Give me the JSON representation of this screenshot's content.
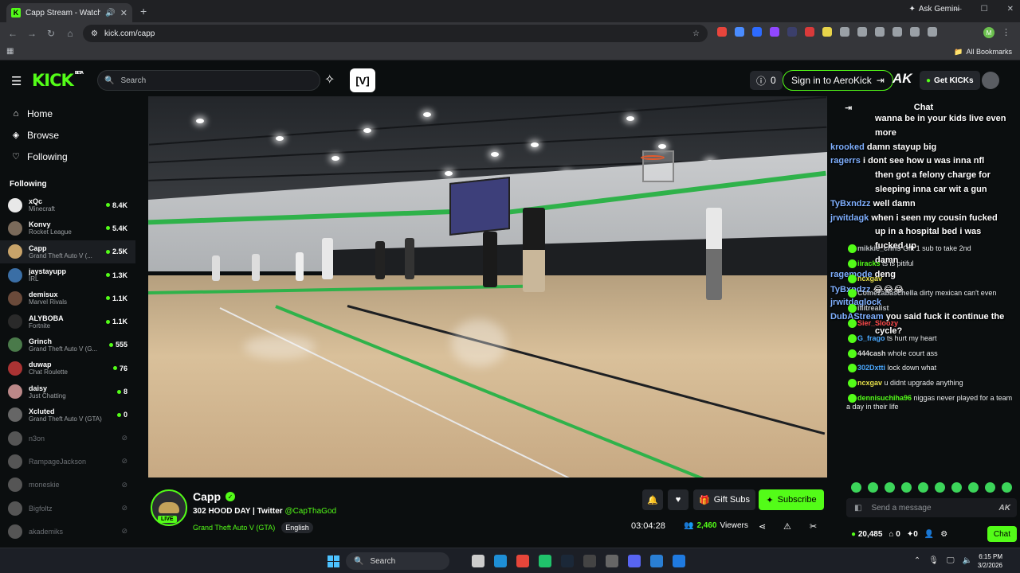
{
  "browser": {
    "tab_title": "Capp Stream - Watch Live ...",
    "tab_favicon": "K",
    "url": "kick.com/capp",
    "ask_gemini": "Ask Gemini",
    "all_bookmarks": "All Bookmarks",
    "profile_initial": "M"
  },
  "header": {
    "logo": "KICK",
    "logo_beta": "BETA",
    "search_placeholder": "Search",
    "notifications": "0",
    "signin_label": "Sign in to AeroKick",
    "ak_logo": "AK",
    "get_kicks": "Get KICKs"
  },
  "sidebar": {
    "nav": [
      {
        "label": "Home",
        "icon": "home-icon"
      },
      {
        "label": "Browse",
        "icon": "compass-icon"
      },
      {
        "label": "Following",
        "icon": "heart-icon"
      }
    ],
    "following_heading": "Following",
    "channels": [
      {
        "name": "xQc",
        "category": "Minecraft",
        "viewers": "8.4K",
        "live": true
      },
      {
        "name": "Konvy",
        "category": "Rocket League",
        "viewers": "5.4K",
        "live": true
      },
      {
        "name": "Capp",
        "category": "Grand Theft Auto V (...",
        "viewers": "2.5K",
        "live": true,
        "active": true
      },
      {
        "name": "jaystayupp",
        "category": "IRL",
        "viewers": "1.3K",
        "live": true
      },
      {
        "name": "demisux",
        "category": "Marvel Rivals",
        "viewers": "1.1K",
        "live": true
      },
      {
        "name": "ALYBOBA",
        "category": "Fortnite",
        "viewers": "1.1K",
        "live": true
      },
      {
        "name": "Grinch",
        "category": "Grand Theft Auto V (G...",
        "viewers": "555",
        "live": true
      },
      {
        "name": "duwap",
        "category": "Chat Roulette",
        "viewers": "76",
        "live": true
      },
      {
        "name": "daisy",
        "category": "Just Chatting",
        "viewers": "8",
        "live": true
      },
      {
        "name": "Xcluted",
        "category": "Grand Theft Auto V (GTA)",
        "viewers": "0",
        "live": true
      },
      {
        "name": "n3on",
        "category": "",
        "viewers": "",
        "live": false
      },
      {
        "name": "RampageJackson",
        "category": "",
        "viewers": "",
        "live": false
      },
      {
        "name": "moneskie",
        "category": "",
        "viewers": "",
        "live": false
      },
      {
        "name": "Bigfoltz",
        "category": "",
        "viewers": "",
        "live": false
      },
      {
        "name": "akademiks",
        "category": "",
        "viewers": "",
        "live": false
      }
    ]
  },
  "stream": {
    "streamer": "Capp",
    "live_badge": "LIVE",
    "title_prefix": "302 HOOD DAY | Twitter",
    "twitter": "@CapThaGod",
    "category": "Grand Theft Auto V (GTA)",
    "language": "English",
    "gift_subs": "Gift Subs",
    "subscribe": "Subscribe",
    "uptime": "03:04:28",
    "viewer_count": "2,460",
    "viewers_label": "Viewers"
  },
  "chat": {
    "title": "Chat",
    "overlay_messages": [
      {
        "user": "",
        "text": "wanna be in your kids live even"
      },
      {
        "user": "",
        "text": "more"
      },
      {
        "user": "krooked",
        "text": "damn stayup big"
      },
      {
        "user": "ragerrs",
        "text": "i dont see how u was inna nfl"
      },
      {
        "user": "",
        "text": "then got a felony charge for"
      },
      {
        "user": "",
        "text": "sleeping inna car wit a gun"
      },
      {
        "user": "TyBxndzz",
        "text": "well damn"
      },
      {
        "user": "jrwitdagk",
        "text": "when i seen my cousin fucked"
      },
      {
        "user": "",
        "text": "up in a hospital bed i was"
      },
      {
        "user": "",
        "text": "fucked up"
      },
      {
        "user": "",
        "text": "damn"
      },
      {
        "user": "ragemode",
        "text": "deng"
      },
      {
        "user": "TyBxndzz",
        "text": "😂😂😂"
      },
      {
        "user": "jrwitdaglock",
        "text": ""
      },
      {
        "user": "DubAStream",
        "text": "you said fuck it continue the"
      },
      {
        "user": "",
        "text": "cycle?"
      }
    ],
    "messages": [
      {
        "user": "mikkie_chris",
        "text": "Gift 1 sub to take 2nd",
        "color": "#b9bdc1"
      },
      {
        "user": "iiracks",
        "text": "ts is pitiful",
        "color": "#53fc18"
      },
      {
        "user": "ncxgav",
        "text": "",
        "color": "#e8e24a"
      },
      {
        "user": "Comezabaschella",
        "text": "dirty mexican can't even",
        "color": "#b9bdc1"
      },
      {
        "user": "illitrealist",
        "text": "",
        "color": "#b9bdc1"
      },
      {
        "user": "Sier_Sloozy",
        "text": "",
        "color": "#ff4a4a"
      },
      {
        "user": "G_frago",
        "text": "ts hurt my heart",
        "color": "#4aa8ff"
      },
      {
        "user": "444cash",
        "text": "whole court ass",
        "color": "#d8d8d8"
      },
      {
        "user": "302Dxtti",
        "text": "lock down what",
        "color": "#4aa8ff"
      },
      {
        "user": "ncxgav",
        "text": "u didnt upgrade anything",
        "color": "#e8e24a"
      },
      {
        "user": "dennisuchiha96",
        "text": "niggas never played for a team a day in their life",
        "color": "#53fc18"
      }
    ],
    "input_placeholder": "Send a message",
    "input_logo": "AK",
    "kicks_balance": "20,485",
    "stat_a": "0",
    "stat_b": "0",
    "chat_button": "Chat"
  },
  "taskbar": {
    "search_label": "Search",
    "time": "6:15 PM",
    "date": "3/2/2026"
  },
  "colors": {
    "kick_green": "#53fc18",
    "background": "#0b0e0f",
    "chrome_dark": "#202124"
  }
}
